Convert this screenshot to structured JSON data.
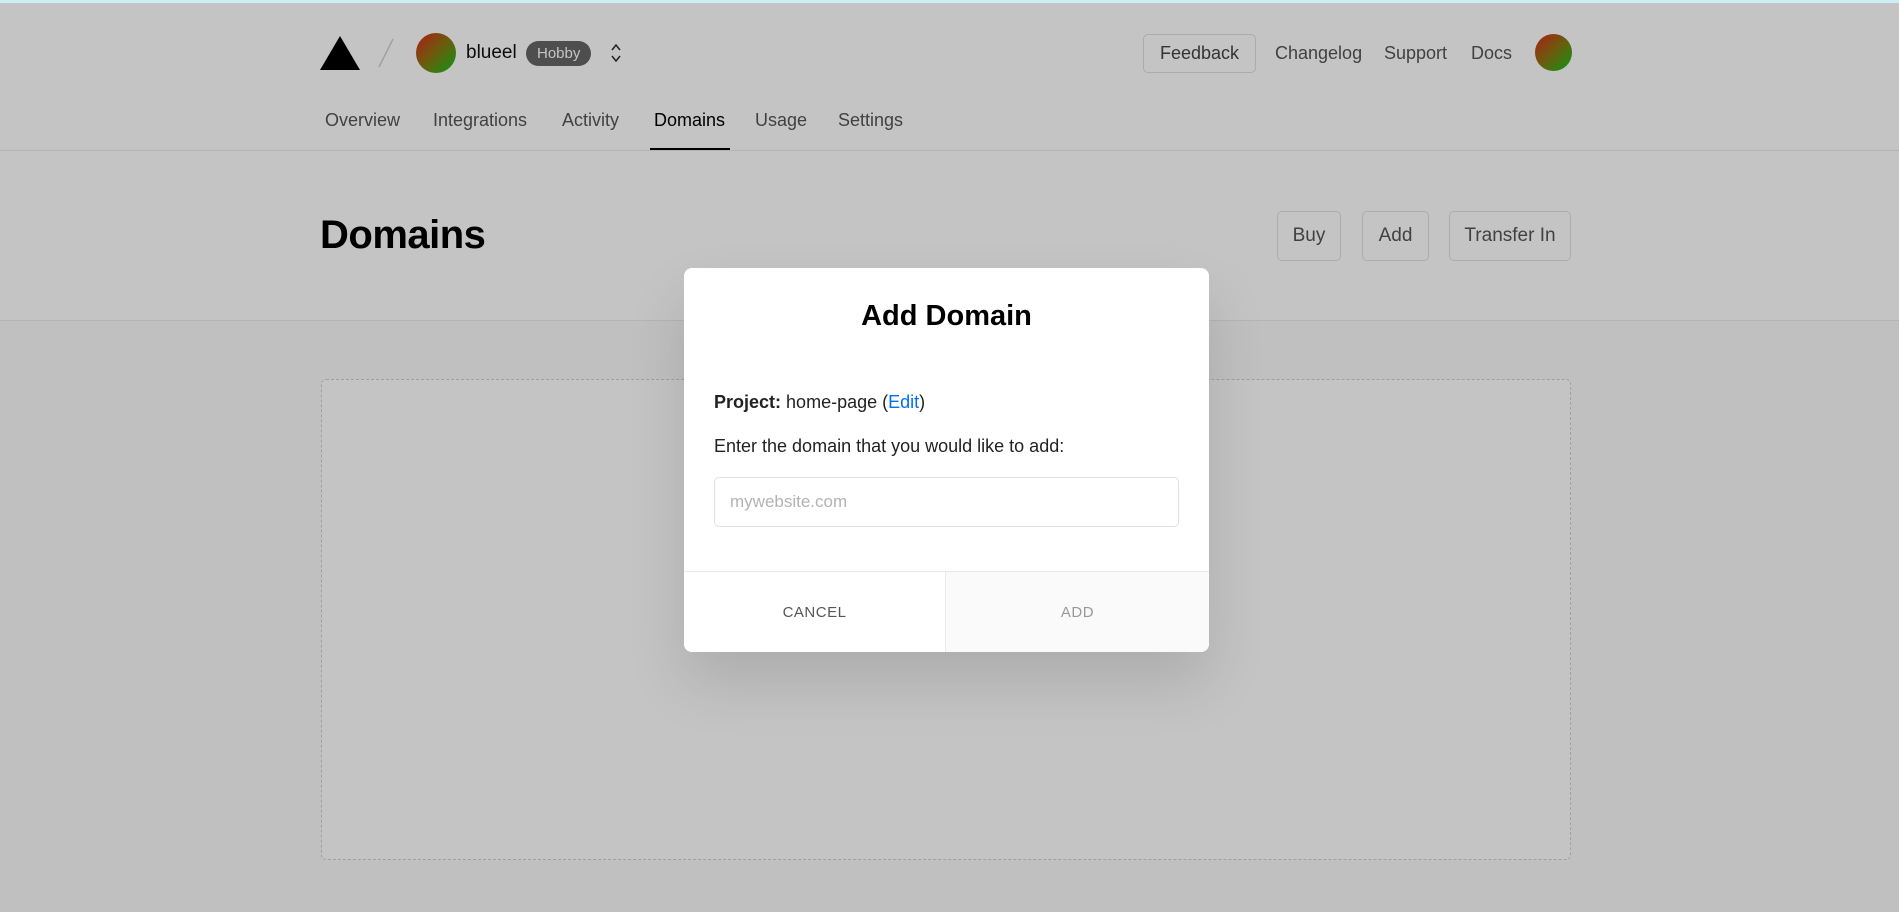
{
  "header": {
    "team_name": "blueel",
    "plan_badge": "Hobby",
    "feedback_label": "Feedback",
    "links": [
      "Changelog",
      "Support",
      "Docs"
    ]
  },
  "tabs": [
    {
      "label": "Overview"
    },
    {
      "label": "Integrations"
    },
    {
      "label": "Activity"
    },
    {
      "label": "Domains",
      "active": true
    },
    {
      "label": "Usage"
    },
    {
      "label": "Settings"
    }
  ],
  "page": {
    "title": "Domains",
    "buttons": {
      "buy": "Buy",
      "add": "Add",
      "transfer_in": "Transfer In"
    }
  },
  "modal": {
    "title": "Add Domain",
    "project_label": "Project:",
    "project_name": "home-page",
    "edit_label": "Edit",
    "prompt": "Enter the domain that you would like to add:",
    "input_placeholder": "mywebsite.com",
    "input_value": "",
    "cancel_label": "CANCEL",
    "add_label": "ADD"
  },
  "colors": {
    "accent_link": "#0070f3",
    "plan_badge_bg": "#666666",
    "avatar_gradient": [
      "#e0261a",
      "#10c41a"
    ]
  },
  "icons": {
    "logo": "triangle-logo-icon",
    "separator": "slash-separator-icon",
    "switcher": "chevron-up-down-icon"
  }
}
